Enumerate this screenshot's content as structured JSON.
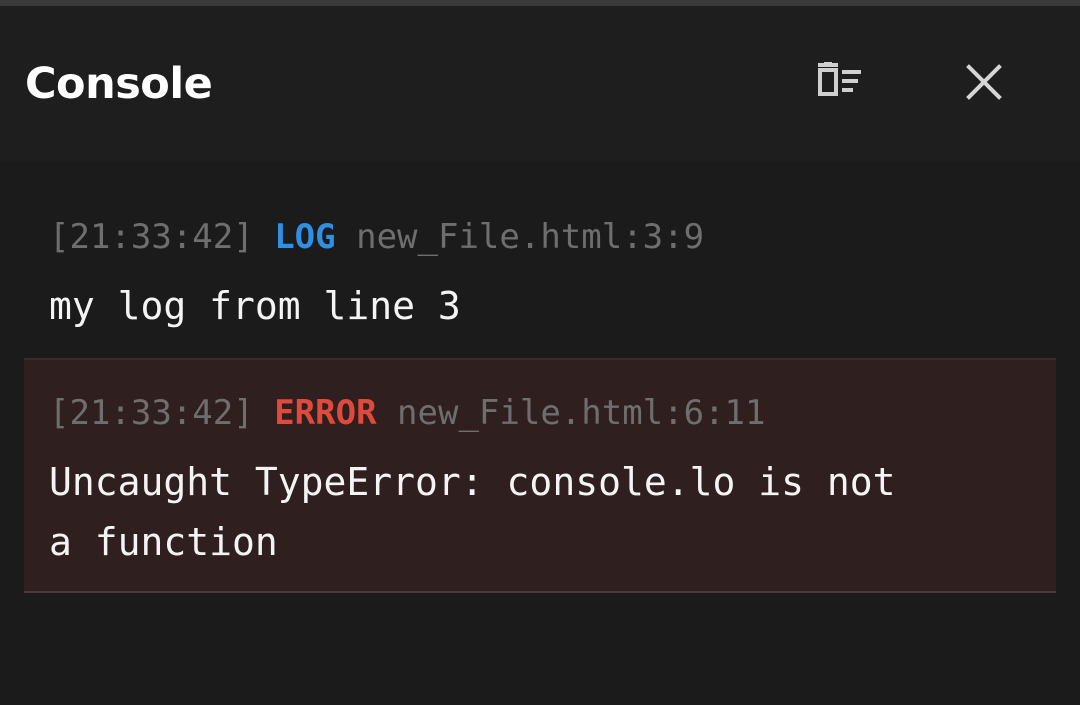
{
  "header": {
    "title": "Console",
    "clear_icon": "clear-all-icon",
    "close_icon": "close-icon"
  },
  "entries": [
    {
      "time": "[21:33:42]",
      "level": "LOG",
      "source": "new_File.html:3:9",
      "message": "my log from line 3",
      "level_color": "#2f8fe2"
    },
    {
      "time": "[21:33:42]",
      "level": "ERROR",
      "source": "new_File.html:6:11",
      "message": "Uncaught TypeError: console.lo is not\na function",
      "level_color": "#e04a3d"
    }
  ],
  "colors": {
    "background": "#1b1b1b",
    "header": "#1e1e1e",
    "error_background": "#2f1f1e",
    "muted_text": "#6e6e6e"
  }
}
